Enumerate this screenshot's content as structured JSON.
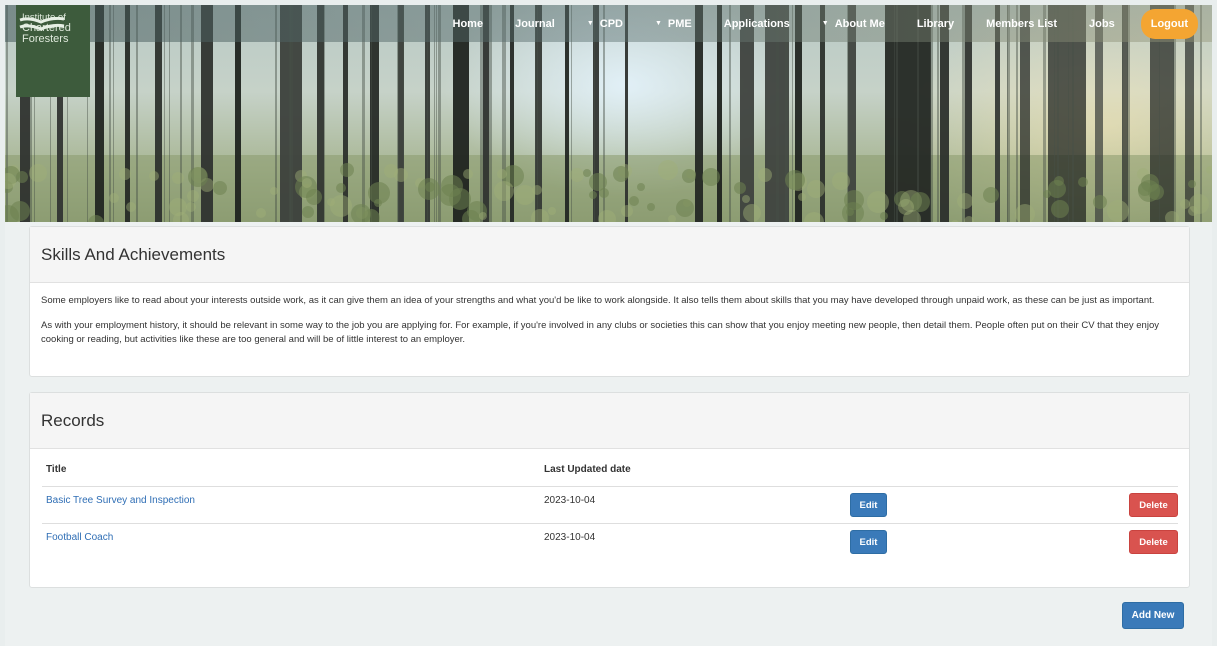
{
  "logo": {
    "line1": "Institute of",
    "line2": "Chartered",
    "line3": "Foresters"
  },
  "nav": {
    "items": [
      {
        "label": "Home",
        "dropdown": false
      },
      {
        "label": "Journal",
        "dropdown": false
      },
      {
        "label": "CPD",
        "dropdown": true
      },
      {
        "label": "PME",
        "dropdown": true
      },
      {
        "label": "Applications",
        "dropdown": false
      },
      {
        "label": "About Me",
        "dropdown": true
      },
      {
        "label": "Library",
        "dropdown": false
      },
      {
        "label": "Members List",
        "dropdown": false
      },
      {
        "label": "Jobs",
        "dropdown": false
      }
    ],
    "logout_label": "Logout",
    "caret_glyph": "▼"
  },
  "skills": {
    "title": "Skills And Achievements",
    "paragraph1": "Some employers like to read about your interests outside work, as it can give them an idea of your strengths and what you'd be like to work alongside. It also tells them about skills that you may have developed through unpaid work, as these can be just as important.",
    "paragraph2": "As with your employment history, it should be relevant in some way to the job you are applying for. For example, if you're involved in any clubs or societies this can show that you enjoy meeting new people, then detail them. People often put on their CV that they enjoy cooking or reading, but activities like these are too general and will be of little interest to an employer."
  },
  "records": {
    "title": "Records",
    "columns": {
      "title": "Title",
      "date": "Last Updated date"
    },
    "rows": [
      {
        "title": "Basic Tree Survey and Inspection",
        "date": "2023-10-04",
        "edit_label": "Edit",
        "delete_label": "Delete"
      },
      {
        "title": "Football Coach",
        "date": "2023-10-04",
        "edit_label": "Edit",
        "delete_label": "Delete"
      }
    ]
  },
  "add_new_label": "Add New",
  "colors": {
    "logo_bg": "#3d5b3c",
    "logout": "#f4a532",
    "primary_button": "#3a7ab9",
    "danger_button": "#d9534f",
    "link": "#2f6eb5"
  }
}
